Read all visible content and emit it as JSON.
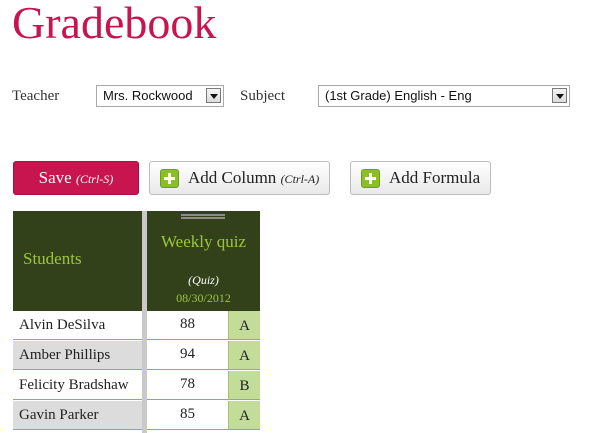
{
  "page": {
    "title": "Gradebook"
  },
  "filters": {
    "teacher_label": "Teacher",
    "teacher_value": "Mrs. Rockwood",
    "subject_label": "Subject",
    "subject_value": "(1st Grade) English - Eng"
  },
  "toolbar": {
    "save_label": "Save",
    "save_shortcut": "(Ctrl-S)",
    "add_column_label": "Add Column",
    "add_column_shortcut": "(Ctrl-A)",
    "add_formula_label": "Add Formula"
  },
  "grid": {
    "students_header": "Students",
    "column": {
      "title": "Weekly quiz",
      "type": "(Quiz)",
      "date": "08/30/2012"
    },
    "rows": [
      {
        "name": "Alvin DeSilva",
        "score": "88",
        "grade": "A"
      },
      {
        "name": "Amber Phillips",
        "score": "94",
        "grade": "A"
      },
      {
        "name": "Felicity Bradshaw",
        "score": "78",
        "grade": "B"
      },
      {
        "name": "Gavin Parker",
        "score": "85",
        "grade": "A"
      }
    ]
  },
  "colors": {
    "brand": "#c8144f",
    "header_bg": "#33411a",
    "accent_green": "#9cc63a",
    "grade_bg": "#c3dc9a"
  }
}
